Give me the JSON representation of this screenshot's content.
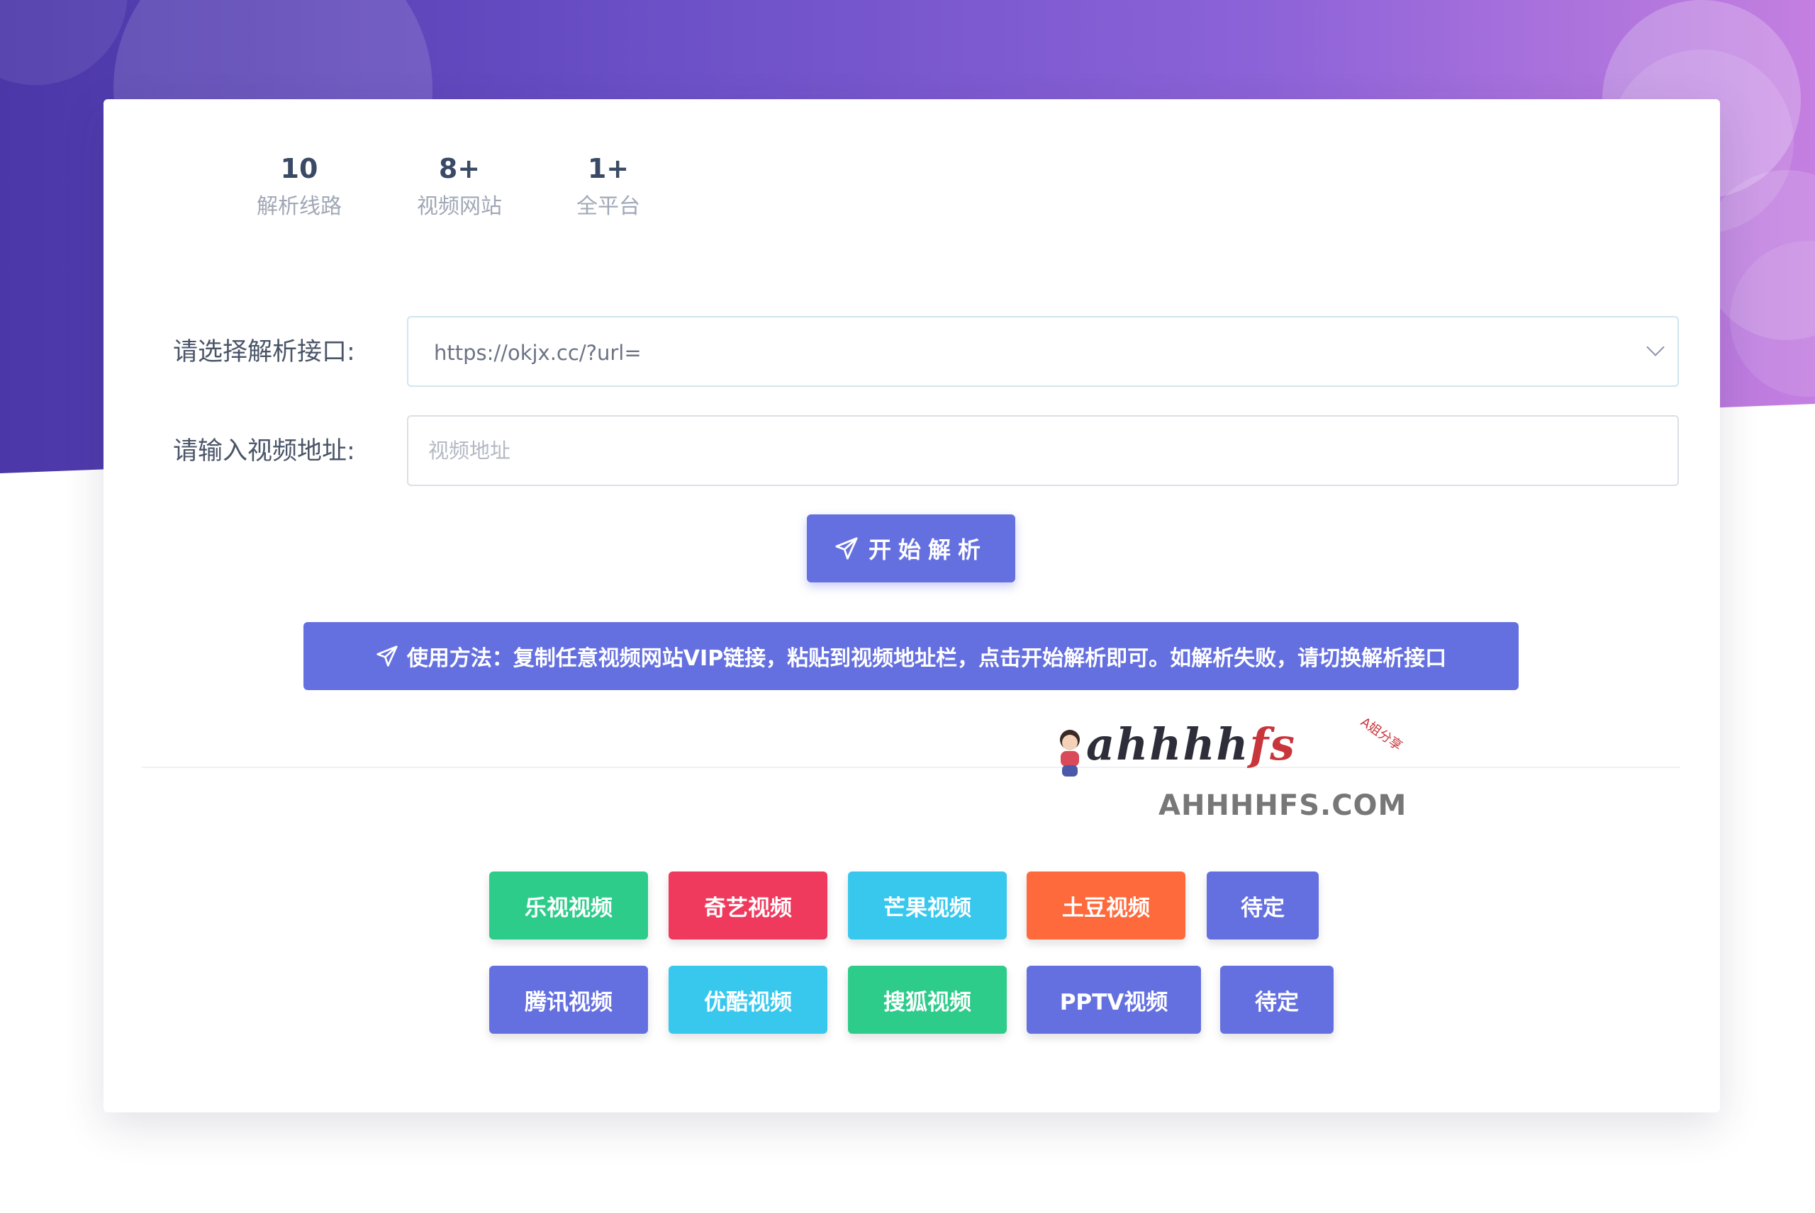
{
  "stats": [
    {
      "value": "10",
      "label": "解析线路"
    },
    {
      "value": "8+",
      "label": "视频网站"
    },
    {
      "value": "1+",
      "label": "全平台"
    }
  ],
  "form": {
    "api_label": "请选择解析接口:",
    "api_selected": "https://okjx.cc/?url=",
    "url_label": "请输入视频地址:",
    "url_placeholder": "视频地址",
    "url_value": ""
  },
  "submit": {
    "label": "开始解析"
  },
  "notice": {
    "text": "使用方法：复制任意视频网站VIP链接，粘贴到视频地址栏，点击开始解析即可。如解析失败，请切换解析接口"
  },
  "watermark": {
    "script_main": "ahhhh",
    "script_accent": "fs",
    "tag": "A姐分享",
    "domain": "AHHHHFS.COM"
  },
  "sites": {
    "row1": [
      {
        "label": "乐视视频",
        "color": "#2ecc8a"
      },
      {
        "label": "奇艺视频",
        "color": "#ef3a5d"
      },
      {
        "label": "芒果视频",
        "color": "#38c8ee"
      },
      {
        "label": "土豆视频",
        "color": "#ff6a3d"
      },
      {
        "label": "待定",
        "color": "#6570e0"
      }
    ],
    "row2": [
      {
        "label": "腾讯视频",
        "color": "#6570e0"
      },
      {
        "label": "优酷视频",
        "color": "#38c8ee"
      },
      {
        "label": "搜狐视频",
        "color": "#2ecc8a"
      },
      {
        "label": "PPTV视频",
        "color": "#6570e0"
      },
      {
        "label": "待定",
        "color": "#6570e0"
      }
    ]
  }
}
